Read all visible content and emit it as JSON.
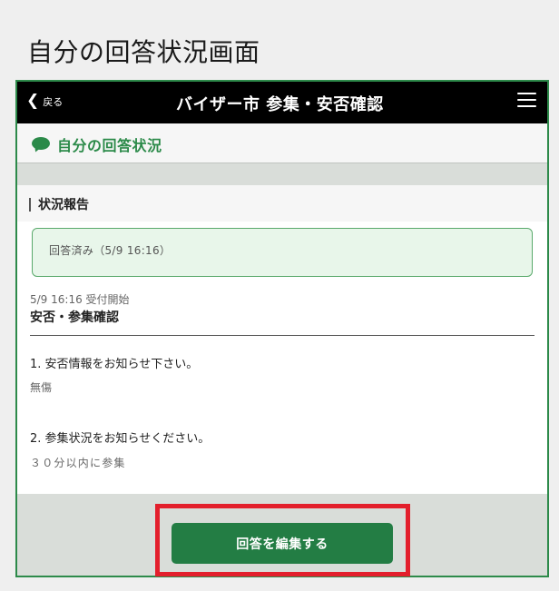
{
  "page": {
    "caption": "自分の回答状況画面"
  },
  "header": {
    "back_label": "戻る",
    "title": "バイザー市 参集・安否確認"
  },
  "subheader": {
    "title": "自分の回答状況"
  },
  "section": {
    "heading": "状況報告"
  },
  "status": {
    "text": "回答済み（5/9 16:16）"
  },
  "survey": {
    "started": "5/9 16:16 受付開始",
    "title": "安否・参集確認",
    "questions": [
      {
        "label": "1. 安否情報をお知らせ下さい。",
        "answer": "無傷"
      },
      {
        "label": "2. 参集状況をお知らせください。",
        "answer": "３０分以内に参集"
      }
    ]
  },
  "actions": {
    "edit_label": "回答を編集する"
  },
  "colors": {
    "primary_green": "#237d44",
    "accent_green": "#2b8a49",
    "highlight_red": "#e31f2c",
    "status_background": "#e8f6ea"
  },
  "icons": {
    "back": "chevron-left-icon",
    "menu": "hamburger-menu-icon",
    "speech": "chat-bubble-icon"
  }
}
